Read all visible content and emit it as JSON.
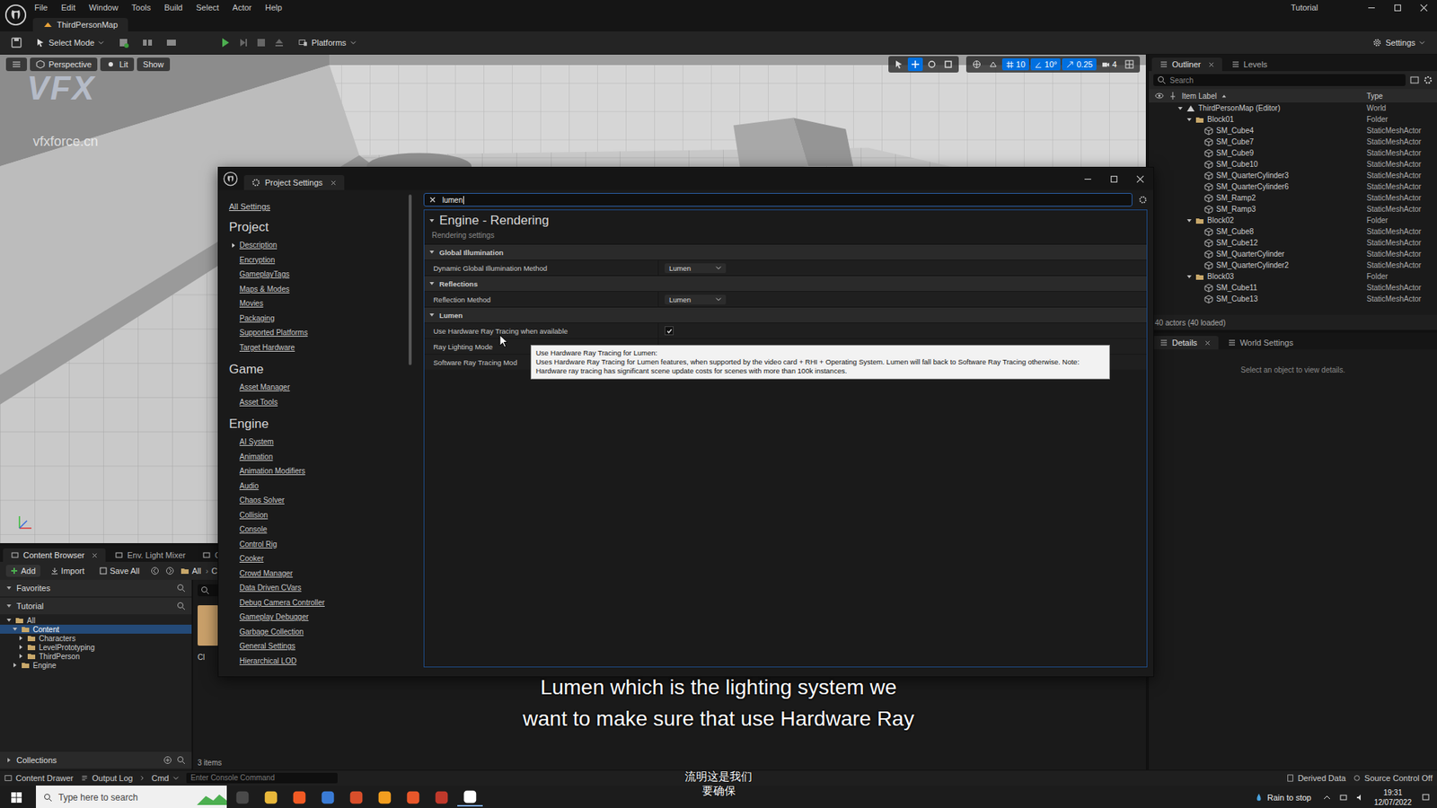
{
  "title_bar": {
    "menu": [
      "File",
      "Edit",
      "Window",
      "Tools",
      "Build",
      "Select",
      "Actor",
      "Help"
    ],
    "project": "Tutorial",
    "map_tab": "ThirdPersonMap"
  },
  "toolbar": {
    "mode": "Select Mode",
    "platforms": "Platforms",
    "settings": "Settings"
  },
  "viewport": {
    "view_mode": "Perspective",
    "lighting": "Lit",
    "show": "Show",
    "grid_snap": "10",
    "rotation_snap": "10°",
    "scale_snap": "0.25",
    "camera_speed": "4",
    "watermark_logo": "VFX",
    "watermark_site": "vfxforce.cn"
  },
  "outliner": {
    "tabs": [
      {
        "label": "Outliner",
        "selected": true
      },
      {
        "label": "Levels",
        "selected": false
      }
    ],
    "search_placeholder": "Search",
    "columns": [
      "Item Label",
      "Type"
    ],
    "rows": [
      {
        "label": "ThirdPersonMap (Editor)",
        "type": "World",
        "kind": "world",
        "expanded": true
      },
      {
        "label": "Block01",
        "type": "Folder",
        "kind": "folder",
        "expanded": true
      },
      {
        "label": "SM_Cube4",
        "type": "StaticMeshActor",
        "kind": "actor"
      },
      {
        "label": "SM_Cube7",
        "type": "StaticMeshActor",
        "kind": "actor"
      },
      {
        "label": "SM_Cube9",
        "type": "StaticMeshActor",
        "kind": "actor"
      },
      {
        "label": "SM_Cube10",
        "type": "StaticMeshActor",
        "kind": "actor"
      },
      {
        "label": "SM_QuarterCylinder3",
        "type": "StaticMeshActor",
        "kind": "actor"
      },
      {
        "label": "SM_QuarterCylinder6",
        "type": "StaticMeshActor",
        "kind": "actor"
      },
      {
        "label": "SM_Ramp2",
        "type": "StaticMeshActor",
        "kind": "actor"
      },
      {
        "label": "SM_Ramp3",
        "type": "StaticMeshActor",
        "kind": "actor"
      },
      {
        "label": "Block02",
        "type": "Folder",
        "kind": "folder",
        "expanded": true
      },
      {
        "label": "SM_Cube8",
        "type": "StaticMeshActor",
        "kind": "actor"
      },
      {
        "label": "SM_Cube12",
        "type": "StaticMeshActor",
        "kind": "actor"
      },
      {
        "label": "SM_QuarterCylinder",
        "type": "StaticMeshActor",
        "kind": "actor"
      },
      {
        "label": "SM_QuarterCylinder2",
        "type": "StaticMeshActor",
        "kind": "actor"
      },
      {
        "label": "Block03",
        "type": "Folder",
        "kind": "folder",
        "expanded": true
      },
      {
        "label": "SM_Cube11",
        "type": "StaticMeshActor",
        "kind": "actor"
      },
      {
        "label": "SM_Cube13",
        "type": "StaticMeshActor",
        "kind": "actor"
      }
    ],
    "footer": "40 actors (40 loaded)"
  },
  "details": {
    "tabs": [
      {
        "label": "Details",
        "selected": true
      },
      {
        "label": "World Settings",
        "selected": false
      }
    ],
    "empty_message": "Select an object to view details."
  },
  "content_browser": {
    "tabs": [
      {
        "label": "Content Browser",
        "selected": true
      },
      {
        "label": "Env. Light Mixer",
        "selected": false
      },
      {
        "label": "Outpu",
        "selected": false
      }
    ],
    "buttons": [
      "Add",
      "Import",
      "Save All"
    ],
    "path": [
      "All",
      "C"
    ],
    "sections": [
      "Favorites",
      "Tutorial"
    ],
    "tree": [
      {
        "label": "All",
        "expanded": true,
        "selected": false,
        "children": [
          {
            "label": "Content",
            "expanded": true,
            "selected": true,
            "children": [
              {
                "label": "Characters",
                "expanded": false,
                "selected": false
              },
              {
                "label": "LevelPrototyping",
                "expanded": false,
                "selected": false
              },
              {
                "label": "ThirdPerson",
                "expanded": false,
                "selected": false
              }
            ]
          },
          {
            "label": "Engine",
            "expanded": false,
            "selected": false
          }
        ]
      }
    ],
    "collections": "Collections",
    "asset_label": "Cl",
    "item_count": "3 items"
  },
  "status_bar": {
    "left": [
      "Content Drawer",
      "Output Log",
      "Cmd"
    ],
    "console_placeholder": "Enter Console Command",
    "right": [
      "Derived Data",
      "Source Control Off"
    ]
  },
  "project_settings": {
    "title": "Project Settings",
    "search": "lumen",
    "all_settings": "All Settings",
    "nav": [
      {
        "heading": "Project",
        "items": [
          {
            "label": "Description",
            "kind": "group"
          },
          {
            "label": "Encryption",
            "kind": "link"
          },
          {
            "label": "GameplayTags",
            "kind": "link"
          },
          {
            "label": "Maps & Modes",
            "kind": "link"
          },
          {
            "label": "Movies",
            "kind": "link"
          },
          {
            "label": "Packaging",
            "kind": "link"
          },
          {
            "label": "Supported Platforms",
            "kind": "link"
          },
          {
            "label": "Target Hardware",
            "kind": "link"
          }
        ]
      },
      {
        "heading": "Game",
        "items": [
          {
            "label": "Asset Manager",
            "kind": "link"
          },
          {
            "label": "Asset Tools",
            "kind": "link"
          }
        ]
      },
      {
        "heading": "Engine",
        "items": [
          {
            "label": "AI System",
            "kind": "link"
          },
          {
            "label": "Animation",
            "kind": "link"
          },
          {
            "label": "Animation Modifiers",
            "kind": "link"
          },
          {
            "label": "Audio",
            "kind": "link"
          },
          {
            "label": "Chaos Solver",
            "kind": "link"
          },
          {
            "label": "Collision",
            "kind": "link"
          },
          {
            "label": "Console",
            "kind": "link"
          },
          {
            "label": "Control Rig",
            "kind": "link"
          },
          {
            "label": "Cooker",
            "kind": "link"
          },
          {
            "label": "Crowd Manager",
            "kind": "link"
          },
          {
            "label": "Data Driven CVars",
            "kind": "link"
          },
          {
            "label": "Debug Camera Controller",
            "kind": "link"
          },
          {
            "label": "Gameplay Debugger",
            "kind": "link"
          },
          {
            "label": "Garbage Collection",
            "kind": "link"
          },
          {
            "label": "General Settings",
            "kind": "link"
          },
          {
            "label": "Hierarchical LOD",
            "kind": "link"
          }
        ]
      }
    ],
    "header": "Engine - Rendering",
    "subheader": "Rendering settings",
    "sections": [
      {
        "title": "Global Illumination",
        "expanded": true,
        "rows": [
          {
            "label": "Dynamic Global Illumination Method",
            "kind": "dropdown",
            "value": "Lumen"
          }
        ]
      },
      {
        "title": "Reflections",
        "expanded": true,
        "rows": [
          {
            "label": "Reflection Method",
            "kind": "dropdown",
            "value": "Lumen"
          }
        ]
      },
      {
        "title": "Lumen",
        "expanded": true,
        "rows": [
          {
            "label": "Use Hardware Ray Tracing when available",
            "kind": "checkbox",
            "checked": true
          },
          {
            "label": "Ray Lighting Mode",
            "kind": "covered"
          },
          {
            "label": "Software Ray Tracing Mod",
            "kind": "covered"
          }
        ]
      }
    ],
    "tooltip": {
      "title": "Use Hardware Ray Tracing for Lumen:",
      "body": "Uses Hardware Ray Tracing for Lumen features, when supported by the video card + RHI + Operating System. Lumen will fall back to Software Ray Tracing otherwise. Note: Hardware ray tracing has significant scene update costs for scenes with more than 100k instances."
    }
  },
  "subtitles": {
    "english": [
      "Lumen which is the lighting system we",
      "want to make sure that use Hardware Ray"
    ],
    "chinese": [
      "流明这是我们",
      "要确保"
    ]
  },
  "taskbar": {
    "search_placeholder": "Type here to search",
    "weather": "Rain to stop",
    "time": "19:31",
    "date": "12/07/2022"
  }
}
